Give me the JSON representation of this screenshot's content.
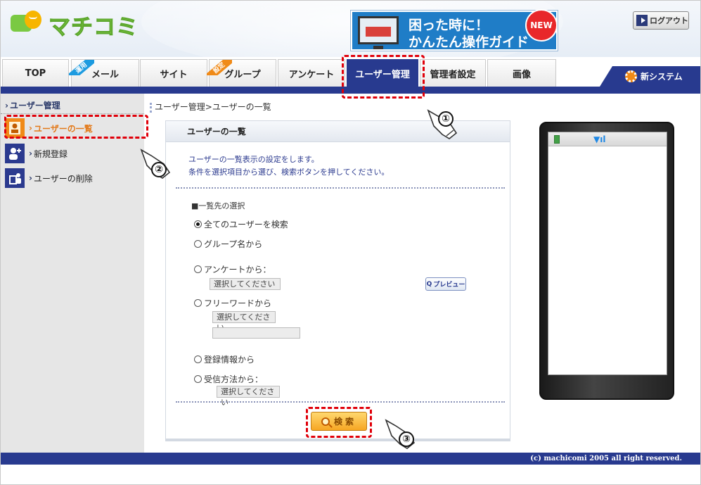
{
  "logo_text": "マチコミ",
  "banner": {
    "line1": "困った時に！",
    "line2": "かんたん操作ガイド",
    "badge": "NEW"
  },
  "logout_label": "ログアウト",
  "nav": {
    "tabs": [
      {
        "label": "TOP"
      },
      {
        "label": "メール",
        "ribbon": "運用"
      },
      {
        "label": "サイト"
      },
      {
        "label": "グループ",
        "ribbon": "設定"
      },
      {
        "label": "アンケート"
      },
      {
        "label": "ユーザー管理",
        "active": true
      },
      {
        "label": "管理者設定"
      },
      {
        "label": "画像"
      }
    ],
    "new_system": "新システム"
  },
  "sidebar": {
    "title": "ユーザー管理",
    "items": [
      {
        "label": "ユーザーの一覧",
        "active": true
      },
      {
        "label": "新規登録"
      },
      {
        "label": "ユーザーの削除"
      }
    ]
  },
  "breadcrumb": "ユーザー管理>ユーザーの一覧",
  "panel": {
    "title": "ユーザーの一覧",
    "desc1": "ユーザーの一覧表示の設定をします。",
    "desc2": "条件を選択項目から選び、検索ボタンを押してください。",
    "section": "■一覧先の選択",
    "options": {
      "all": "全てのユーザーを検索",
      "group": "グループ名から",
      "survey": "アンケートから：",
      "freeword": "フリーワードから",
      "registration": "登録情報から",
      "delivery": "受信方法から："
    },
    "select_placeholder": "選択してください",
    "preview_label": "プレビュー",
    "search_label": "検索"
  },
  "callouts": [
    "①",
    "②",
    "③"
  ],
  "footer": "(c) machicomi 2005 all right reserved.",
  "colors": {
    "navy": "#283a8f",
    "accent_orange": "#e37a1b",
    "annotation_red": "#e0000a"
  }
}
